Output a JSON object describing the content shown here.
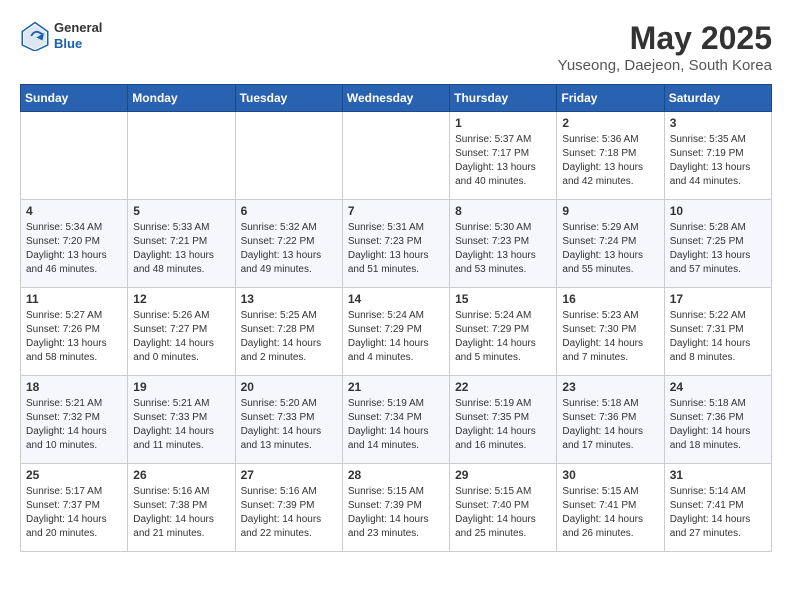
{
  "header": {
    "logo_general": "General",
    "logo_blue": "Blue",
    "month_year": "May 2025",
    "location": "Yuseong, Daejeon, South Korea"
  },
  "weekdays": [
    "Sunday",
    "Monday",
    "Tuesday",
    "Wednesday",
    "Thursday",
    "Friday",
    "Saturday"
  ],
  "weeks": [
    [
      {
        "day": "",
        "sunrise": "",
        "sunset": "",
        "daylight": ""
      },
      {
        "day": "",
        "sunrise": "",
        "sunset": "",
        "daylight": ""
      },
      {
        "day": "",
        "sunrise": "",
        "sunset": "",
        "daylight": ""
      },
      {
        "day": "",
        "sunrise": "",
        "sunset": "",
        "daylight": ""
      },
      {
        "day": "1",
        "sunrise": "Sunrise: 5:37 AM",
        "sunset": "Sunset: 7:17 PM",
        "daylight": "Daylight: 13 hours and 40 minutes."
      },
      {
        "day": "2",
        "sunrise": "Sunrise: 5:36 AM",
        "sunset": "Sunset: 7:18 PM",
        "daylight": "Daylight: 13 hours and 42 minutes."
      },
      {
        "day": "3",
        "sunrise": "Sunrise: 5:35 AM",
        "sunset": "Sunset: 7:19 PM",
        "daylight": "Daylight: 13 hours and 44 minutes."
      }
    ],
    [
      {
        "day": "4",
        "sunrise": "Sunrise: 5:34 AM",
        "sunset": "Sunset: 7:20 PM",
        "daylight": "Daylight: 13 hours and 46 minutes."
      },
      {
        "day": "5",
        "sunrise": "Sunrise: 5:33 AM",
        "sunset": "Sunset: 7:21 PM",
        "daylight": "Daylight: 13 hours and 48 minutes."
      },
      {
        "day": "6",
        "sunrise": "Sunrise: 5:32 AM",
        "sunset": "Sunset: 7:22 PM",
        "daylight": "Daylight: 13 hours and 49 minutes."
      },
      {
        "day": "7",
        "sunrise": "Sunrise: 5:31 AM",
        "sunset": "Sunset: 7:23 PM",
        "daylight": "Daylight: 13 hours and 51 minutes."
      },
      {
        "day": "8",
        "sunrise": "Sunrise: 5:30 AM",
        "sunset": "Sunset: 7:23 PM",
        "daylight": "Daylight: 13 hours and 53 minutes."
      },
      {
        "day": "9",
        "sunrise": "Sunrise: 5:29 AM",
        "sunset": "Sunset: 7:24 PM",
        "daylight": "Daylight: 13 hours and 55 minutes."
      },
      {
        "day": "10",
        "sunrise": "Sunrise: 5:28 AM",
        "sunset": "Sunset: 7:25 PM",
        "daylight": "Daylight: 13 hours and 57 minutes."
      }
    ],
    [
      {
        "day": "11",
        "sunrise": "Sunrise: 5:27 AM",
        "sunset": "Sunset: 7:26 PM",
        "daylight": "Daylight: 13 hours and 58 minutes."
      },
      {
        "day": "12",
        "sunrise": "Sunrise: 5:26 AM",
        "sunset": "Sunset: 7:27 PM",
        "daylight": "Daylight: 14 hours and 0 minutes."
      },
      {
        "day": "13",
        "sunrise": "Sunrise: 5:25 AM",
        "sunset": "Sunset: 7:28 PM",
        "daylight": "Daylight: 14 hours and 2 minutes."
      },
      {
        "day": "14",
        "sunrise": "Sunrise: 5:24 AM",
        "sunset": "Sunset: 7:29 PM",
        "daylight": "Daylight: 14 hours and 4 minutes."
      },
      {
        "day": "15",
        "sunrise": "Sunrise: 5:24 AM",
        "sunset": "Sunset: 7:29 PM",
        "daylight": "Daylight: 14 hours and 5 minutes."
      },
      {
        "day": "16",
        "sunrise": "Sunrise: 5:23 AM",
        "sunset": "Sunset: 7:30 PM",
        "daylight": "Daylight: 14 hours and 7 minutes."
      },
      {
        "day": "17",
        "sunrise": "Sunrise: 5:22 AM",
        "sunset": "Sunset: 7:31 PM",
        "daylight": "Daylight: 14 hours and 8 minutes."
      }
    ],
    [
      {
        "day": "18",
        "sunrise": "Sunrise: 5:21 AM",
        "sunset": "Sunset: 7:32 PM",
        "daylight": "Daylight: 14 hours and 10 minutes."
      },
      {
        "day": "19",
        "sunrise": "Sunrise: 5:21 AM",
        "sunset": "Sunset: 7:33 PM",
        "daylight": "Daylight: 14 hours and 11 minutes."
      },
      {
        "day": "20",
        "sunrise": "Sunrise: 5:20 AM",
        "sunset": "Sunset: 7:33 PM",
        "daylight": "Daylight: 14 hours and 13 minutes."
      },
      {
        "day": "21",
        "sunrise": "Sunrise: 5:19 AM",
        "sunset": "Sunset: 7:34 PM",
        "daylight": "Daylight: 14 hours and 14 minutes."
      },
      {
        "day": "22",
        "sunrise": "Sunrise: 5:19 AM",
        "sunset": "Sunset: 7:35 PM",
        "daylight": "Daylight: 14 hours and 16 minutes."
      },
      {
        "day": "23",
        "sunrise": "Sunrise: 5:18 AM",
        "sunset": "Sunset: 7:36 PM",
        "daylight": "Daylight: 14 hours and 17 minutes."
      },
      {
        "day": "24",
        "sunrise": "Sunrise: 5:18 AM",
        "sunset": "Sunset: 7:36 PM",
        "daylight": "Daylight: 14 hours and 18 minutes."
      }
    ],
    [
      {
        "day": "25",
        "sunrise": "Sunrise: 5:17 AM",
        "sunset": "Sunset: 7:37 PM",
        "daylight": "Daylight: 14 hours and 20 minutes."
      },
      {
        "day": "26",
        "sunrise": "Sunrise: 5:16 AM",
        "sunset": "Sunset: 7:38 PM",
        "daylight": "Daylight: 14 hours and 21 minutes."
      },
      {
        "day": "27",
        "sunrise": "Sunrise: 5:16 AM",
        "sunset": "Sunset: 7:39 PM",
        "daylight": "Daylight: 14 hours and 22 minutes."
      },
      {
        "day": "28",
        "sunrise": "Sunrise: 5:15 AM",
        "sunset": "Sunset: 7:39 PM",
        "daylight": "Daylight: 14 hours and 23 minutes."
      },
      {
        "day": "29",
        "sunrise": "Sunrise: 5:15 AM",
        "sunset": "Sunset: 7:40 PM",
        "daylight": "Daylight: 14 hours and 25 minutes."
      },
      {
        "day": "30",
        "sunrise": "Sunrise: 5:15 AM",
        "sunset": "Sunset: 7:41 PM",
        "daylight": "Daylight: 14 hours and 26 minutes."
      },
      {
        "day": "31",
        "sunrise": "Sunrise: 5:14 AM",
        "sunset": "Sunset: 7:41 PM",
        "daylight": "Daylight: 14 hours and 27 minutes."
      }
    ]
  ]
}
